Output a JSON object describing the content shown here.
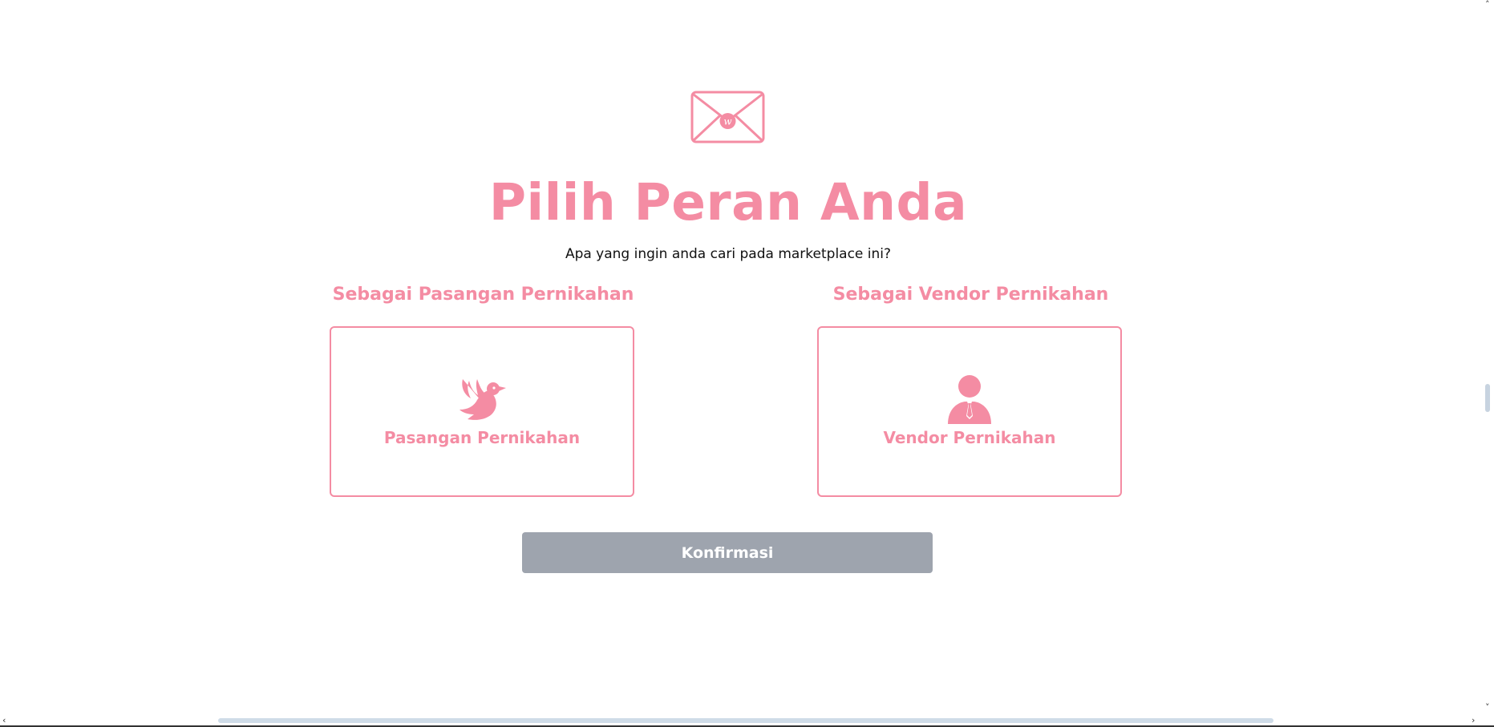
{
  "heading": {
    "title": "Pilih Peran Anda",
    "subtitle": "Apa yang ingin anda cari pada marketplace ini?"
  },
  "roles": [
    {
      "section_label": "Sebagai Pasangan Pernikahan",
      "card_label": "Pasangan Pernikahan",
      "icon": "dove-icon"
    },
    {
      "section_label": "Sebagai Vendor Pernikahan",
      "card_label": "Vendor Pernikahan",
      "icon": "businessman-icon"
    }
  ],
  "logo": {
    "icon": "envelope-icon",
    "monogram": "w"
  },
  "confirm_button": {
    "label": "Konfirmasi"
  },
  "colors": {
    "accent": "#f48ca3",
    "button_disabled": "#9ea4ae",
    "text": "#111111",
    "background": "#ffffff"
  },
  "scrollbars": {
    "left_arrow": "‹",
    "right_arrow": "›",
    "up_arrow": "˄",
    "down_arrow": "˅"
  }
}
